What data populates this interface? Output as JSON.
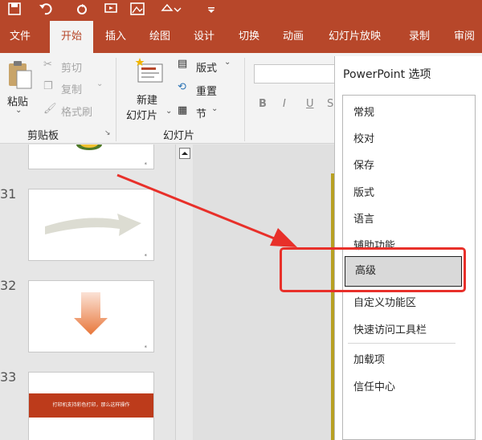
{
  "tabs": [
    {
      "label": "文件",
      "active": false
    },
    {
      "label": "开始",
      "active": true
    },
    {
      "label": "插入",
      "active": false
    },
    {
      "label": "绘图",
      "active": false
    },
    {
      "label": "设计",
      "active": false
    },
    {
      "label": "切换",
      "active": false
    },
    {
      "label": "动画",
      "active": false
    },
    {
      "label": "幻灯片放映",
      "active": false
    },
    {
      "label": "录制",
      "active": false
    },
    {
      "label": "审阅",
      "active": false
    }
  ],
  "clipboard": {
    "paste": "粘贴",
    "cut": "剪切",
    "copy": "复制",
    "format_painter": "格式刷",
    "group_label": "剪贴板"
  },
  "slides_group": {
    "new_slide_line1": "新建",
    "new_slide_line2": "幻灯片",
    "layout": "版式",
    "reset": "重置",
    "section": "节",
    "group_label": "幻灯片"
  },
  "font_group": {
    "bold": "B",
    "italic": "I",
    "underline": "U",
    "strike": "S"
  },
  "thumbnails": {
    "numbers": [
      "31",
      "32",
      "33"
    ],
    "slide33_banner": "打印机支持彩色打印，那么这样操作"
  },
  "dialog": {
    "title": "PowerPoint 选项",
    "categories": [
      "常规",
      "校对",
      "保存",
      "版式",
      "语言",
      "辅助功能",
      "高级",
      "自定义功能区",
      "快速访问工具栏",
      "加载项",
      "信任中心"
    ],
    "selected": "高级"
  },
  "colors": {
    "brand": "#b7472a",
    "highlight": "#e8302a",
    "selected_bg": "#d9d9d9"
  }
}
